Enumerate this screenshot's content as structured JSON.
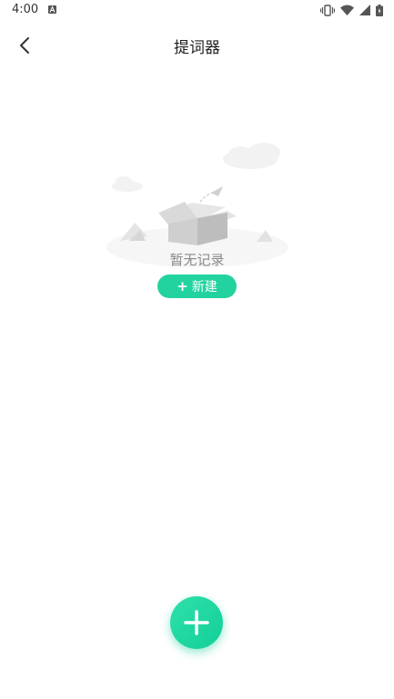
{
  "status_bar": {
    "time": "4:00",
    "icons": [
      "notification-a-icon",
      "vibrate-icon",
      "wifi-icon",
      "signal-icon",
      "battery-icon"
    ]
  },
  "header": {
    "title": "提词器",
    "back_icon": "chevron-left-icon"
  },
  "empty_state": {
    "illustration": "empty-box-icon",
    "message": "暂无记录",
    "new_button": {
      "icon": "+",
      "label": "新建"
    }
  },
  "fab": {
    "icon": "plus-icon"
  },
  "colors": {
    "accent": "#22d3a0",
    "title_text": "#222222",
    "muted_text": "#8a8a8a",
    "background": "#ffffff"
  }
}
